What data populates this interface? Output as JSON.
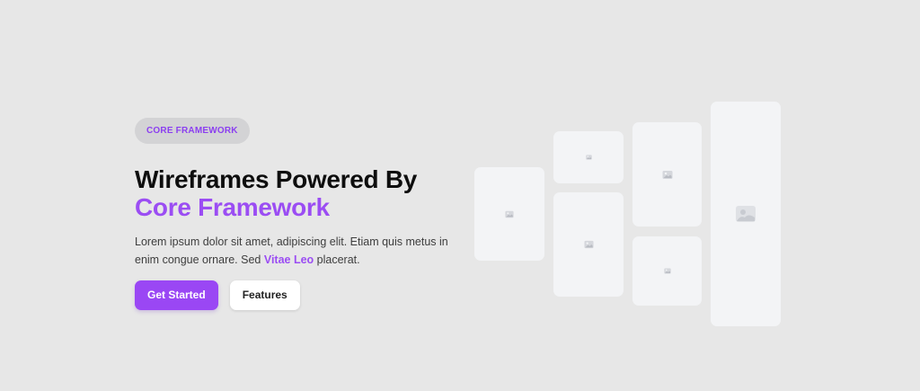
{
  "hero": {
    "badge": "CORE FRAMEWORK",
    "headline_line1": "Wireframes Powered By",
    "headline_line2": "Core Framework",
    "description_part1": "Lorem ipsum dolor sit amet, adipiscing elit. Etiam quis metus in enim congue ornare. Sed ",
    "description_highlight": "Vitae Leo",
    "description_part2": " placerat.",
    "primary_button": "Get Started",
    "secondary_button": "Features"
  },
  "gallery": {
    "icon": "image-placeholder-icon",
    "card_count": 6
  },
  "colors": {
    "accent": "#9b4df3",
    "background": "#e7e7e7",
    "card": "#f3f4f6"
  }
}
